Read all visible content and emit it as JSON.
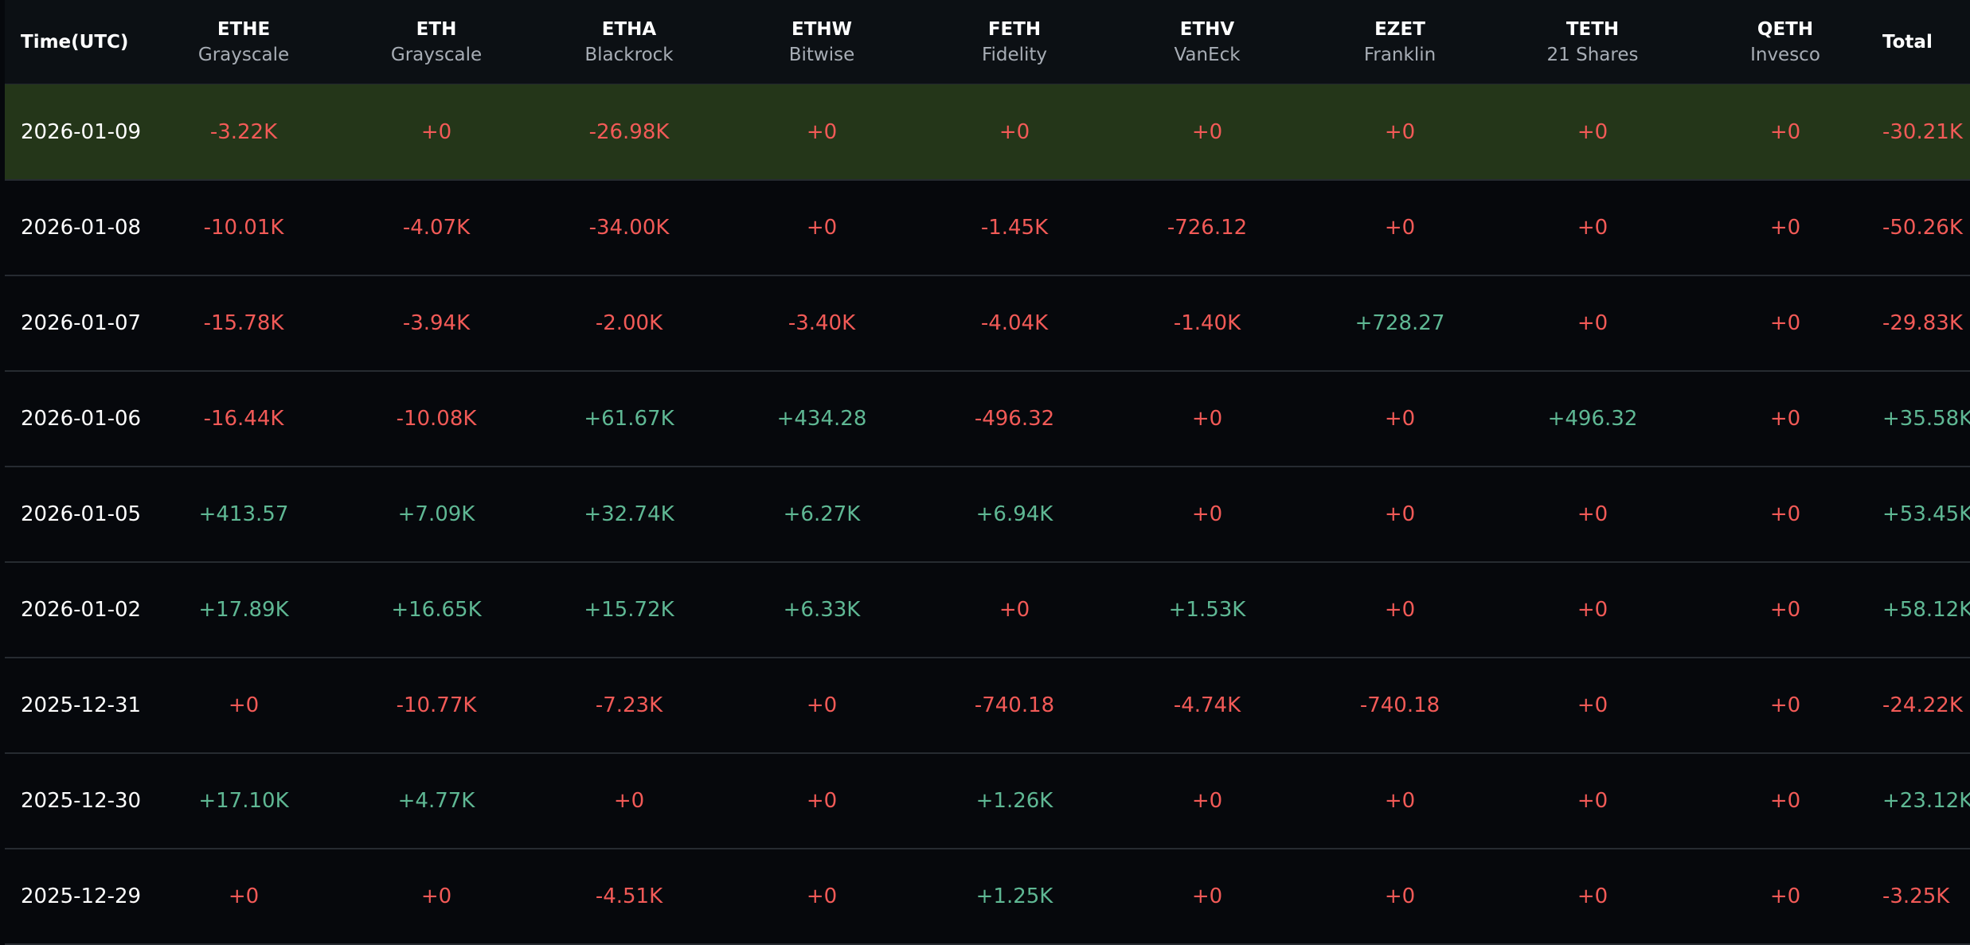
{
  "colors": {
    "positive": "#5fb894",
    "negative": "#f25a57",
    "highlight_row": "#243619",
    "background": "#06080c"
  },
  "table": {
    "time_header": "Time(UTC)",
    "total_header": "Total",
    "columns": [
      {
        "ticker": "ETHE",
        "issuer": "Grayscale"
      },
      {
        "ticker": "ETH",
        "issuer": "Grayscale"
      },
      {
        "ticker": "ETHA",
        "issuer": "Blackrock"
      },
      {
        "ticker": "ETHW",
        "issuer": "Bitwise"
      },
      {
        "ticker": "FETH",
        "issuer": "Fidelity"
      },
      {
        "ticker": "ETHV",
        "issuer": "VanEck"
      },
      {
        "ticker": "EZET",
        "issuer": "Franklin"
      },
      {
        "ticker": "TETH",
        "issuer": "21 Shares"
      },
      {
        "ticker": "QETH",
        "issuer": "Invesco"
      }
    ],
    "rows": [
      {
        "date": "2026-01-09",
        "values": [
          "-3.22K",
          "+0",
          "-26.98K",
          "+0",
          "+0",
          "+0",
          "+0",
          "+0",
          "+0"
        ],
        "total": "-30.21K",
        "highlighted": true
      },
      {
        "date": "2026-01-08",
        "values": [
          "-10.01K",
          "-4.07K",
          "-34.00K",
          "+0",
          "-1.45K",
          "-726.12",
          "+0",
          "+0",
          "+0"
        ],
        "total": "-50.26K",
        "highlighted": false
      },
      {
        "date": "2026-01-07",
        "values": [
          "-15.78K",
          "-3.94K",
          "-2.00K",
          "-3.40K",
          "-4.04K",
          "-1.40K",
          "+728.27",
          "+0",
          "+0"
        ],
        "total": "-29.83K",
        "highlighted": false
      },
      {
        "date": "2026-01-06",
        "values": [
          "-16.44K",
          "-10.08K",
          "+61.67K",
          "+434.28",
          "-496.32",
          "+0",
          "+0",
          "+496.32",
          "+0"
        ],
        "total": "+35.58K",
        "highlighted": false
      },
      {
        "date": "2026-01-05",
        "values": [
          "+413.57",
          "+7.09K",
          "+32.74K",
          "+6.27K",
          "+6.94K",
          "+0",
          "+0",
          "+0",
          "+0"
        ],
        "total": "+53.45K",
        "highlighted": false
      },
      {
        "date": "2026-01-02",
        "values": [
          "+17.89K",
          "+16.65K",
          "+15.72K",
          "+6.33K",
          "+0",
          "+1.53K",
          "+0",
          "+0",
          "+0"
        ],
        "total": "+58.12K",
        "highlighted": false
      },
      {
        "date": "2025-12-31",
        "values": [
          "+0",
          "-10.77K",
          "-7.23K",
          "+0",
          "-740.18",
          "-4.74K",
          "-740.18",
          "+0",
          "+0"
        ],
        "total": "-24.22K",
        "highlighted": false
      },
      {
        "date": "2025-12-30",
        "values": [
          "+17.10K",
          "+4.77K",
          "+0",
          "+0",
          "+1.26K",
          "+0",
          "+0",
          "+0",
          "+0"
        ],
        "total": "+23.12K",
        "highlighted": false
      },
      {
        "date": "2025-12-29",
        "values": [
          "+0",
          "+0",
          "-4.51K",
          "+0",
          "+1.25K",
          "+0",
          "+0",
          "+0",
          "+0"
        ],
        "total": "-3.25K",
        "highlighted": false
      }
    ]
  }
}
